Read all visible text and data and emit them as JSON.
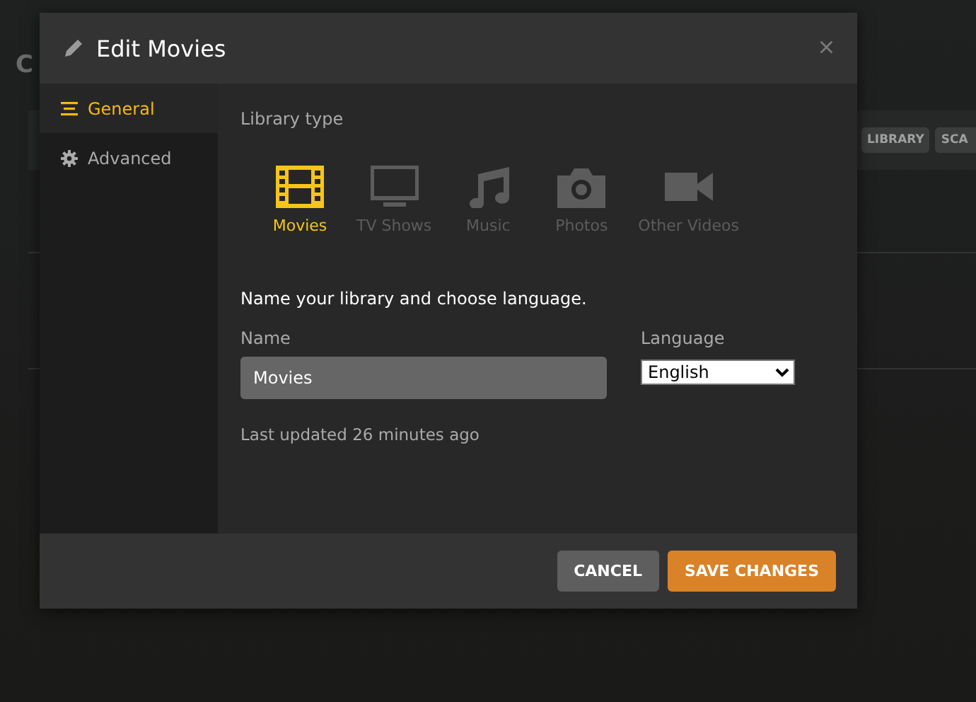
{
  "background": {
    "title": "C",
    "buttons": [
      "LIBRARY",
      "SCA"
    ]
  },
  "dialog": {
    "title": "Edit Movies",
    "close": "×",
    "sidebar": [
      {
        "label": "General",
        "kind": "general",
        "selected": true
      },
      {
        "label": "Advanced",
        "kind": "advanced",
        "selected": false
      }
    ],
    "library_type_label": "Library type",
    "library_types": [
      {
        "label": "Movies",
        "kind": "movies",
        "selected": true
      },
      {
        "label": "TV Shows",
        "kind": "tv",
        "selected": false
      },
      {
        "label": "Music",
        "kind": "music",
        "selected": false
      },
      {
        "label": "Photos",
        "kind": "photos",
        "selected": false
      },
      {
        "label": "Other Videos",
        "kind": "video",
        "selected": false
      }
    ],
    "instruction": "Name your library and choose language.",
    "name_label": "Name",
    "name_value": "Movies",
    "language_label": "Language",
    "language_value": "English",
    "last_updated": "Last updated 26 minutes ago",
    "buttons": [
      {
        "label": "CANCEL",
        "kind": "secondary"
      },
      {
        "label": "SAVE CHANGES",
        "kind": "primary"
      }
    ]
  }
}
